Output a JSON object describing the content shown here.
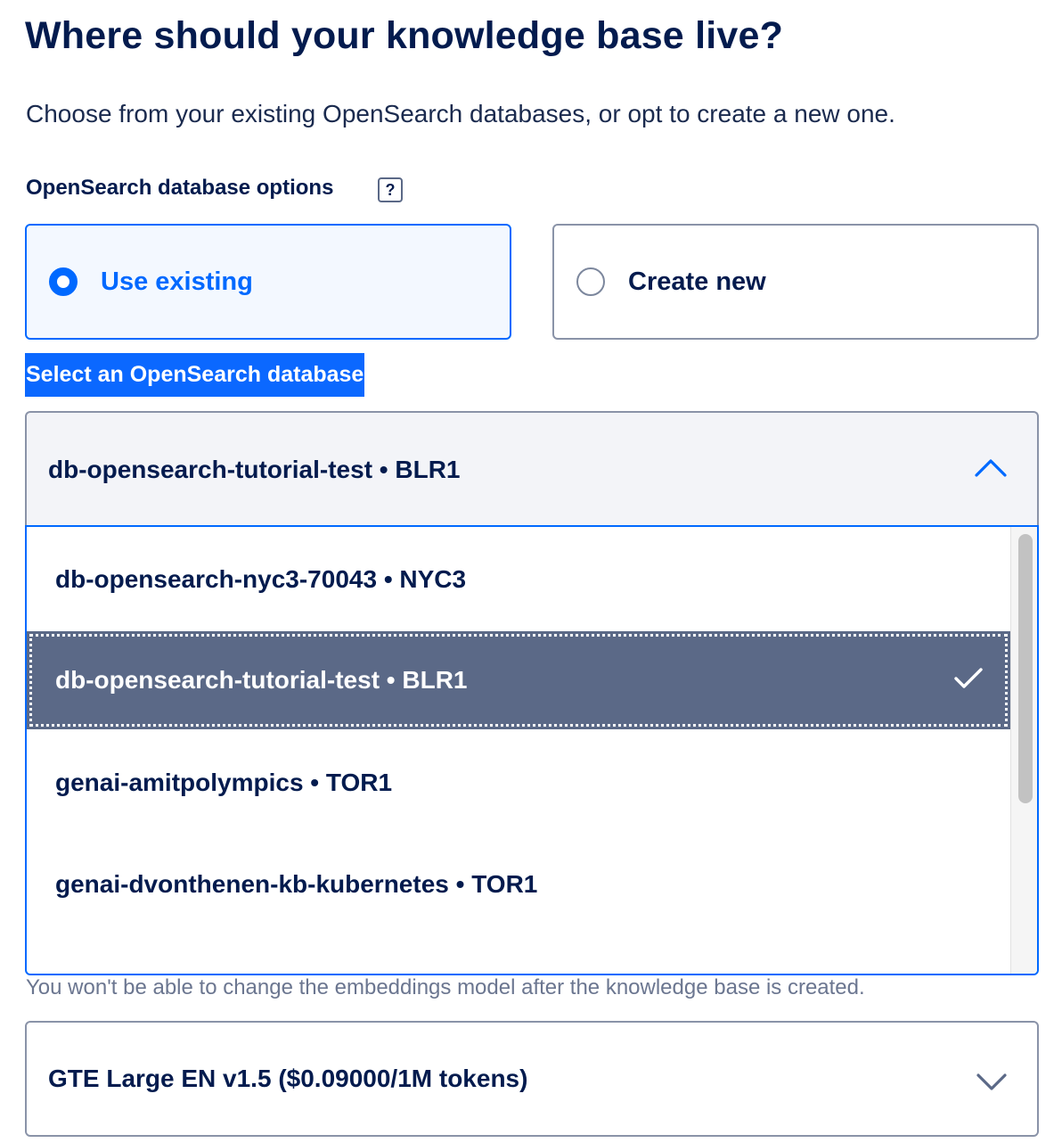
{
  "header": {
    "title": "Where should your knowledge base live?",
    "subtitle": "Choose from your existing OpenSearch databases, or opt to create a new one."
  },
  "database_options": {
    "label": "OpenSearch database options",
    "help_icon": "?",
    "choices": [
      {
        "label": "Use existing",
        "selected": true
      },
      {
        "label": "Create new",
        "selected": false
      }
    ]
  },
  "database_select": {
    "label": "Select an OpenSearch database",
    "selected_value": "db-opensearch-tutorial-test • BLR1",
    "expanded": true,
    "options": [
      {
        "label": "db-opensearch-nyc3-70043 • NYC3",
        "selected": false
      },
      {
        "label": "db-opensearch-tutorial-test • BLR1",
        "selected": true
      },
      {
        "label": "genai-amitpolympics • TOR1",
        "selected": false
      },
      {
        "label": "genai-dvonthenen-kb-kubernetes • TOR1",
        "selected": false
      }
    ]
  },
  "embeddings": {
    "note": "You won't be able to change the embeddings model after the knowledge base is created.",
    "selected_value": "GTE Large EN v1.5 ($0.09000/1M tokens)"
  },
  "icons": {
    "help": "question-mark-icon",
    "expand": "chevron-up-icon",
    "collapse": "chevron-down-icon",
    "selected": "checkmark-icon"
  },
  "colors": {
    "accent": "#0069ff",
    "text": "#031b4e",
    "active_option_bg": "#5b6987",
    "muted_text": "#6b7690"
  }
}
